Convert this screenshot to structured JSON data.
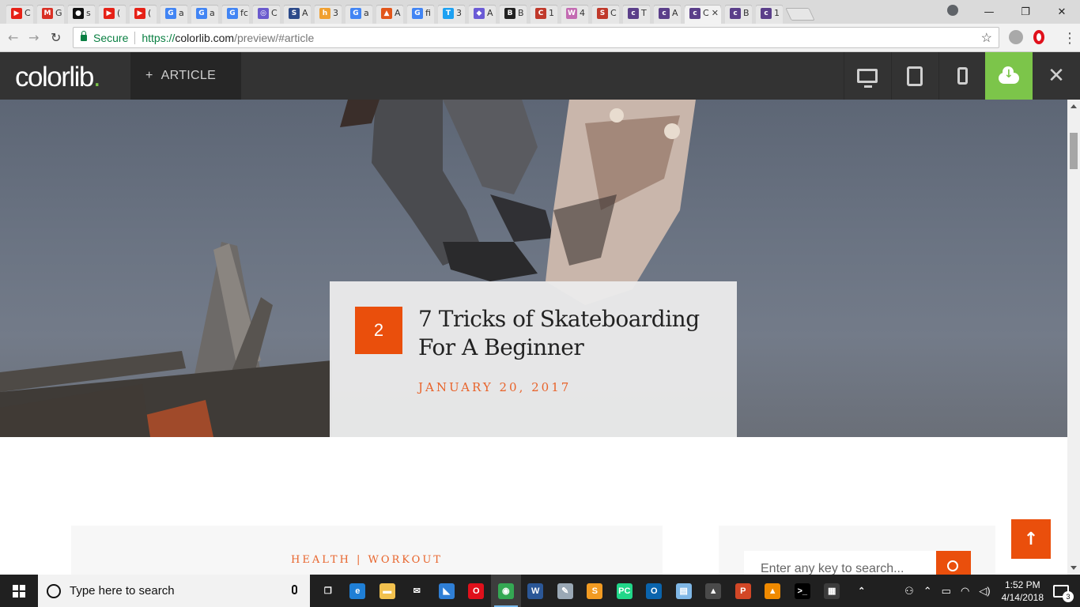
{
  "browser": {
    "tabs": [
      {
        "icon": "youtube-icon",
        "color": "#e62117",
        "glyph": "▶",
        "text": "C"
      },
      {
        "icon": "gmail-icon",
        "color": "#d93025",
        "glyph": "M",
        "text": "G"
      },
      {
        "icon": "github-icon",
        "color": "#111111",
        "glyph": "●",
        "text": "s"
      },
      {
        "icon": "youtube-icon",
        "color": "#e62117",
        "glyph": "▶",
        "text": "("
      },
      {
        "icon": "youtube-icon",
        "color": "#e62117",
        "glyph": "▶",
        "text": "("
      },
      {
        "icon": "google-icon",
        "color": "#4285f4",
        "glyph": "G",
        "text": "a"
      },
      {
        "icon": "google-icon",
        "color": "#4285f4",
        "glyph": "G",
        "text": "a"
      },
      {
        "icon": "google-icon",
        "color": "#4285f4",
        "glyph": "G",
        "text": "fc"
      },
      {
        "icon": "satellite-icon",
        "color": "#6a5acd",
        "glyph": "◎",
        "text": "C"
      },
      {
        "icon": "s-icon",
        "color": "#2c4a8a",
        "glyph": "S",
        "text": "A"
      },
      {
        "icon": "her-icon",
        "color": "#f0a030",
        "glyph": "h",
        "text": "3"
      },
      {
        "icon": "google-icon",
        "color": "#4285f4",
        "glyph": "G",
        "text": "a"
      },
      {
        "icon": "fire-icon",
        "color": "#e2561a",
        "glyph": "▲",
        "text": "A"
      },
      {
        "icon": "google-icon",
        "color": "#4285f4",
        "glyph": "G",
        "text": "fi"
      },
      {
        "icon": "t-icon",
        "color": "#1da1f2",
        "glyph": "T",
        "text": "3"
      },
      {
        "icon": "shield-icon",
        "color": "#6b5bd6",
        "glyph": "◆",
        "text": "A"
      },
      {
        "icon": "b-icon",
        "color": "#222222",
        "glyph": "B",
        "text": "B"
      },
      {
        "icon": "c-icon",
        "color": "#c0392b",
        "glyph": "C",
        "text": "1"
      },
      {
        "icon": "w-icon",
        "color": "#c36bb2",
        "glyph": "W",
        "text": "4"
      },
      {
        "icon": "s-icon",
        "color": "#c0392b",
        "glyph": "S",
        "text": "C"
      },
      {
        "icon": "colorlib-icon",
        "color": "#5b3f8a",
        "glyph": "c",
        "text": "T"
      },
      {
        "icon": "colorlib-icon",
        "color": "#5b3f8a",
        "glyph": "c",
        "text": "A"
      },
      {
        "icon": "colorlib-icon",
        "color": "#5b3f8a",
        "glyph": "c",
        "text": "C",
        "active": true
      },
      {
        "icon": "colorlib-icon",
        "color": "#5b3f8a",
        "glyph": "c",
        "text": "B"
      },
      {
        "icon": "colorlib-icon",
        "color": "#5b3f8a",
        "glyph": "c",
        "text": "1"
      }
    ],
    "secure_label": "Secure",
    "url_scheme": "https://",
    "url_host": "colorlib.com",
    "url_path": "/preview/#article"
  },
  "colorlib": {
    "logo": "colorlib",
    "logo_dot": ".",
    "theme_tab_label": "ARTICLE",
    "theme_tab_prefix": "+",
    "close_glyph": "✕"
  },
  "article": {
    "number": "2",
    "title": "7 Tricks of Skateboarding For A Beginner",
    "date": "JANUARY 20, 2017",
    "categories": "HEALTH | WORKOUT",
    "search_placeholder": "Enter any key to search...",
    "back_to_top_glyph": "↑"
  },
  "taskbar": {
    "search_placeholder": "Type here to search",
    "time": "1:52 PM",
    "date": "4/14/2018",
    "notifications": "3",
    "apps": [
      {
        "name": "task-view-icon",
        "glyph": "❐",
        "color": "transparent"
      },
      {
        "name": "edge-icon",
        "glyph": "e",
        "color": "#1f7fd6"
      },
      {
        "name": "file-explorer-icon",
        "glyph": "▬",
        "color": "#f2c14e"
      },
      {
        "name": "mail-icon",
        "glyph": "✉",
        "color": "transparent"
      },
      {
        "name": "app-sail-icon",
        "glyph": "◣",
        "color": "#2f7fd6"
      },
      {
        "name": "opera-icon",
        "glyph": "O",
        "color": "#e0101b"
      },
      {
        "name": "chrome-icon",
        "glyph": "◉",
        "color": "#34a853",
        "active": true
      },
      {
        "name": "word-icon",
        "glyph": "W",
        "color": "#2b5797"
      },
      {
        "name": "paint-icon",
        "glyph": "✎",
        "color": "#9aa8b5"
      },
      {
        "name": "sublime-icon",
        "glyph": "S",
        "color": "#f29b22"
      },
      {
        "name": "pycharm-icon",
        "glyph": "PC",
        "color": "#21d789"
      },
      {
        "name": "outlook-icon",
        "glyph": "O",
        "color": "#0a64ad"
      },
      {
        "name": "notepad-icon",
        "glyph": "▤",
        "color": "#7fb7e6"
      },
      {
        "name": "photos-icon",
        "glyph": "▲",
        "color": "#4a4a4a"
      },
      {
        "name": "powerpoint-icon",
        "glyph": "P",
        "color": "#d24726"
      },
      {
        "name": "vlc-icon",
        "glyph": "▲",
        "color": "#f08a00"
      },
      {
        "name": "terminal-icon",
        "glyph": ">_",
        "color": "#000000"
      },
      {
        "name": "movie-icon",
        "glyph": "▦",
        "color": "#3b3b3b"
      },
      {
        "name": "chevron-icon",
        "glyph": "⌃",
        "color": "transparent"
      }
    ]
  }
}
